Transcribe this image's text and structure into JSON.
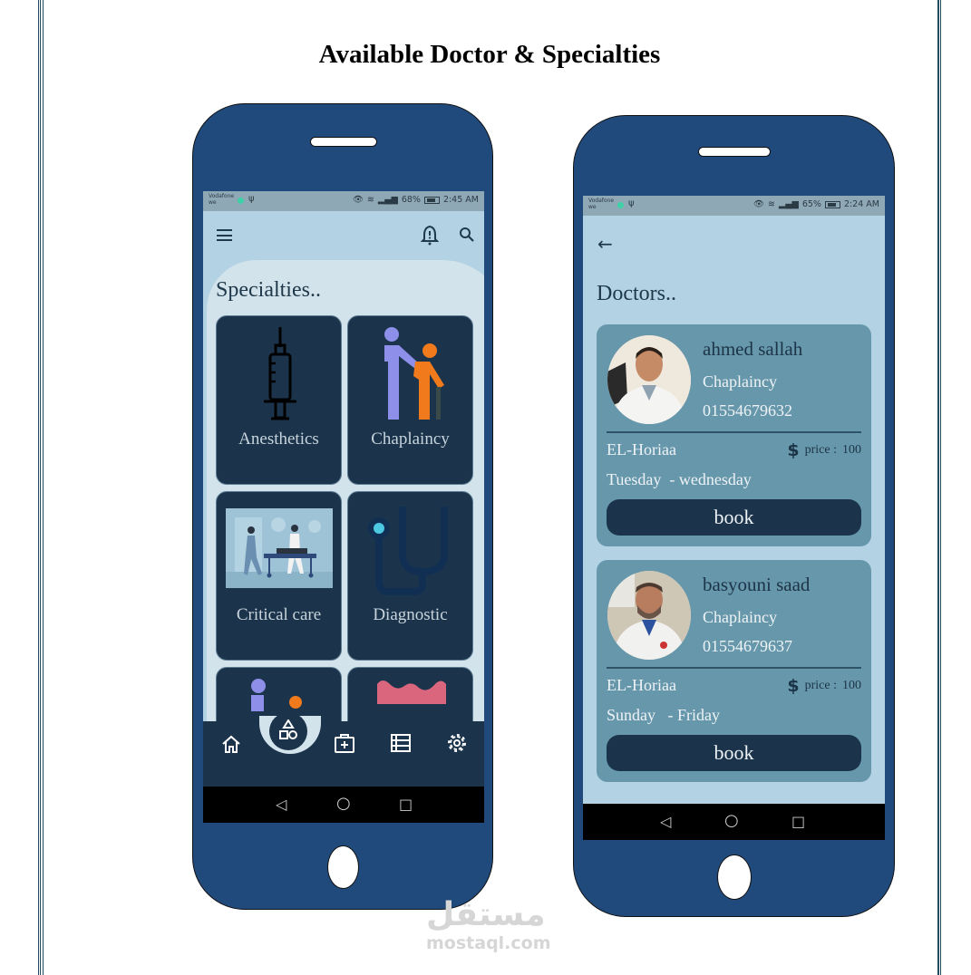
{
  "document": {
    "title": "Available Doctor & Specialties",
    "watermark_arabic": "مستقل",
    "watermark_text": "mostaql.com"
  },
  "phone1": {
    "statusbar": {
      "carrier": "Vodafone",
      "carrier_sub": "we",
      "battery_percent": "68%",
      "time": "2:45 AM"
    },
    "header": {
      "menu_icon": "hamburger-menu-icon",
      "notification_icon": "bell-alert-icon",
      "search_icon": "search-icon"
    },
    "section_title": "Specialties..",
    "specialties": [
      {
        "label": "Anesthetics",
        "icon": "syringe-icon"
      },
      {
        "label": "Chaplaincy",
        "icon": "caregiver-icon"
      },
      {
        "label": "Critical care",
        "icon": "stretcher-illustration"
      },
      {
        "label": "Diagnostic",
        "icon": "stethoscope-icon"
      },
      {
        "label": "",
        "icon": "people-icon"
      },
      {
        "label": "",
        "icon": "intestine-icon"
      }
    ],
    "bottom_nav": [
      {
        "name": "home",
        "icon": "home-icon"
      },
      {
        "name": "specialties",
        "icon": "shapes-icon",
        "active": true
      },
      {
        "name": "doctors",
        "icon": "medical-kit-icon"
      },
      {
        "name": "list",
        "icon": "list-icon"
      },
      {
        "name": "settings",
        "icon": "gear-icon"
      }
    ],
    "system_nav": {
      "back": "◁",
      "home": "○",
      "recents": "□"
    }
  },
  "phone2": {
    "statusbar": {
      "carrier": "Vodafone",
      "carrier_sub": "we",
      "battery_percent": "65%",
      "time": "2:24 AM"
    },
    "back_icon": "←",
    "section_title": "Doctors..",
    "doctors": [
      {
        "name": "ahmed sallah",
        "specialty": "Chaplaincy",
        "phone": "01554679632",
        "location": "EL-Horiaa",
        "price_label": "price :",
        "price": "100",
        "days": "Tuesday  - wednesday",
        "book_label": "book"
      },
      {
        "name": "basyouni saad",
        "specialty": "Chaplaincy",
        "phone": "01554679637",
        "location": "EL-Horiaa",
        "price_label": "price :",
        "price": "100",
        "days": "Sunday   - Friday",
        "book_label": "book"
      }
    ],
    "system_nav": {
      "back": "◁",
      "home": "○",
      "recents": "□"
    }
  },
  "colors": {
    "phone_body": "#214a7c",
    "screen_bg": "#b3d2e4",
    "card_dark": "#1b344b",
    "doctor_card": "#6797ab",
    "border_lines": "#234a5f"
  }
}
